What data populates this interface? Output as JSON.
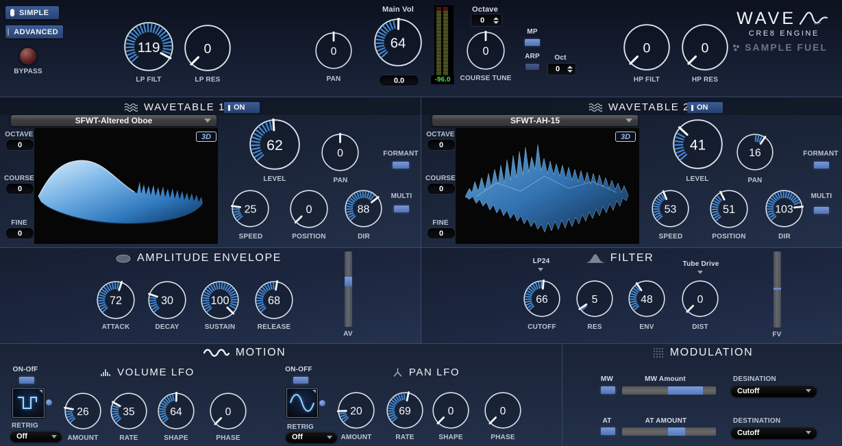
{
  "header": {
    "simple_label": "SIMPLE",
    "advanced_label": "ADVANCED",
    "bypass_label": "BYPASS",
    "lp_filt": {
      "label": "LP FILT",
      "value": 119
    },
    "lp_res": {
      "label": "LP RES",
      "value": 0
    },
    "pan": {
      "label": "PAN",
      "value": 0,
      "bipolar": true
    },
    "main_vol": {
      "label": "Main Vol",
      "value": 64,
      "readout": "0.0"
    },
    "meter_readout": "-96.0",
    "octave": {
      "label": "Octave",
      "value": "0"
    },
    "course_tune": {
      "label": "COURSE TUNE",
      "value": 0,
      "bipolar": true
    },
    "mp_label": "MP",
    "arp_label": "ARP",
    "oct": {
      "label": "Oct",
      "value": "0"
    },
    "hp_filt": {
      "label": "HP FILT",
      "value": 0
    },
    "hp_res": {
      "label": "HP RES",
      "value": 0
    },
    "logo": {
      "title": "WAVE",
      "engine": "CRE8 ENGINE",
      "brand": "SAMPLE FUEL"
    }
  },
  "wavetable1": {
    "title": "WAVETABLE 1",
    "on_label": "ON",
    "preset": "SFWT-Altered Oboe",
    "threed_label": "3D",
    "octave": {
      "label": "OCTAVE",
      "value": "0"
    },
    "course": {
      "label": "COURSE",
      "value": "0"
    },
    "fine": {
      "label": "FINE",
      "value": "0"
    },
    "level": {
      "label": "LEVEL",
      "value": 62
    },
    "pan": {
      "label": "PAN",
      "value": 0,
      "bipolar": true
    },
    "speed": {
      "label": "SPEED",
      "value": 25
    },
    "position": {
      "label": "POSITION",
      "value": 0
    },
    "dir": {
      "label": "DIR",
      "value": 88
    },
    "formant_label": "FORMANT",
    "multi_label": "MULTI"
  },
  "wavetable2": {
    "title": "WAVETABLE 2",
    "on_label": "ON",
    "preset": "SFWT-AH-15",
    "threed_label": "3D",
    "octave": {
      "label": "OCTAVE",
      "value": "0"
    },
    "course": {
      "label": "COURSE",
      "value": "0"
    },
    "fine": {
      "label": "FINE",
      "value": "0"
    },
    "level": {
      "label": "LEVEL",
      "value": 41
    },
    "pan": {
      "label": "PAN",
      "value": 16,
      "bipolar": true
    },
    "speed": {
      "label": "SPEED",
      "value": 53
    },
    "position": {
      "label": "POSITION",
      "value": 51
    },
    "dir": {
      "label": "DIR",
      "value": 103
    },
    "formant_label": "FORMANT",
    "multi_label": "MULTI"
  },
  "amp_env": {
    "title": "AMPLITUDE ENVELOPE",
    "attack": {
      "label": "ATTACK",
      "value": 72
    },
    "decay": {
      "label": "DECAY",
      "value": 30
    },
    "sustain": {
      "label": "SUSTAIN",
      "value": 100,
      "max": 100
    },
    "release": {
      "label": "RELEASE",
      "value": 68
    },
    "av": {
      "label": "AV",
      "percent": 39
    }
  },
  "filter": {
    "title": "FILTER",
    "type_value": "LP24",
    "drive_value": "Tube Drive",
    "cutoff": {
      "label": "CUTOFF",
      "value": 66
    },
    "res": {
      "label": "RES",
      "value": 5
    },
    "env": {
      "label": "ENV",
      "value": 48
    },
    "dist": {
      "label": "DIST",
      "value": 0
    },
    "fv": {
      "label": "FV",
      "percent": 49
    }
  },
  "motion": {
    "title": "MOTION",
    "volume_lfo": {
      "title": "VOLUME LFO",
      "on_off_label": "ON-OfF",
      "retrig_label": "RETRIG",
      "retrig_value": "Off",
      "amount": {
        "label": "AMOUNT",
        "value": 26
      },
      "rate": {
        "label": "RATE",
        "value": 35
      },
      "shape": {
        "label": "SHAPE",
        "value": 64
      },
      "phase": {
        "label": "PHASE",
        "value": 0
      }
    },
    "pan_lfo": {
      "title": "PAN LFO",
      "on_off_label": "ON-OFF",
      "retrig_label": "RETRIG",
      "retrig_value": "Off",
      "amount": {
        "label": "AMOUNT",
        "value": 20
      },
      "rate": {
        "label": "RATE",
        "value": 69
      },
      "shape": {
        "label": "SHAPE",
        "value": 0
      },
      "phase": {
        "label": "PHASE",
        "value": 0
      }
    }
  },
  "modulation": {
    "title": "MODULATION",
    "mw": {
      "label": "MW",
      "amount_label": "MW Amount",
      "dest_label": "DESINATION",
      "dest_value": "Cutoff",
      "fill_start": 49,
      "fill_end": 86
    },
    "at": {
      "label": "AT",
      "amount_label": "AT AMOUNT",
      "dest_label": "DESTINATION",
      "dest_value": "Cutoff",
      "fill_start": 49,
      "fill_end": 67
    }
  }
}
